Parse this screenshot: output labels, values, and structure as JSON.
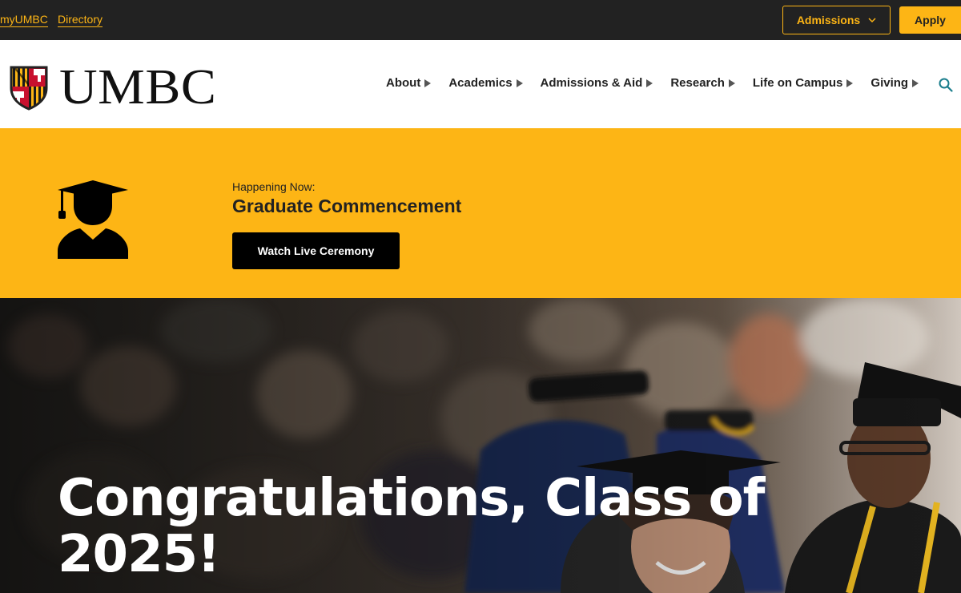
{
  "utility_bar": {
    "links": [
      "myUMBC",
      "Directory"
    ],
    "admissions_label": "Admissions",
    "apply_label": "Apply"
  },
  "header": {
    "logo_text": "UMBC",
    "nav": [
      "About",
      "Academics",
      "Admissions & Aid",
      "Research",
      "Life on Campus",
      "Giving"
    ]
  },
  "banner": {
    "eyebrow": "Happening Now:",
    "title": "Graduate Commencement",
    "button_label": "Watch Live Ceremony"
  },
  "hero": {
    "heading_line1": "Congratulations, Class of",
    "heading_line2": "2025!"
  },
  "colors": {
    "gold": "#fdb515",
    "dark": "#222222",
    "black": "#000000",
    "white": "#ffffff",
    "search_teal": "#1a7d8c"
  },
  "icons": [
    "chevron-down-icon",
    "caret-right-icon",
    "search-icon",
    "graduate-icon",
    "shield-icon"
  ]
}
